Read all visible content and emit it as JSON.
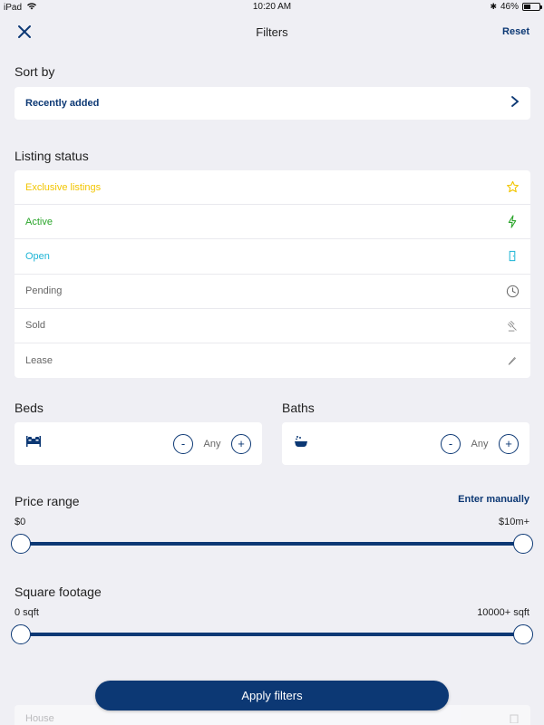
{
  "status_bar": {
    "device": "iPad",
    "time": "10:20 AM",
    "battery": "46%",
    "battery_level": 0.46
  },
  "nav": {
    "title": "Filters",
    "reset_label": "Reset"
  },
  "sort": {
    "section_title": "Sort by",
    "selected": "Recently added"
  },
  "listing_status": {
    "section_title": "Listing status",
    "items": [
      {
        "label": "Exclusive listings",
        "color": "#f2c500",
        "icon": "star-icon"
      },
      {
        "label": "Active",
        "color": "#2aa52a",
        "icon": "lightning-icon"
      },
      {
        "label": "Open",
        "color": "#1fb5d6",
        "icon": "door-icon"
      },
      {
        "label": "Pending",
        "color": "#666666",
        "icon": "clock-icon"
      },
      {
        "label": "Sold",
        "color": "#666666",
        "icon": "gavel-icon"
      },
      {
        "label": "Lease",
        "color": "#666666",
        "icon": "pen-icon"
      }
    ]
  },
  "beds": {
    "section_title": "Beds",
    "value": "Any",
    "minus": "-",
    "plus": "+"
  },
  "baths": {
    "section_title": "Baths",
    "value": "Any",
    "minus": "-",
    "plus": "+"
  },
  "price": {
    "section_title": "Price range",
    "enter_manually": "Enter manually",
    "min_label": "$0",
    "max_label": "$10m+"
  },
  "sqft": {
    "section_title": "Square footage",
    "min_label": "0 sqft",
    "max_label": "10000+ sqft"
  },
  "property_type": {
    "first_item": "House"
  },
  "apply_button": "Apply filters",
  "colors": {
    "accent": "#0c3874",
    "background": "#efeff4"
  }
}
